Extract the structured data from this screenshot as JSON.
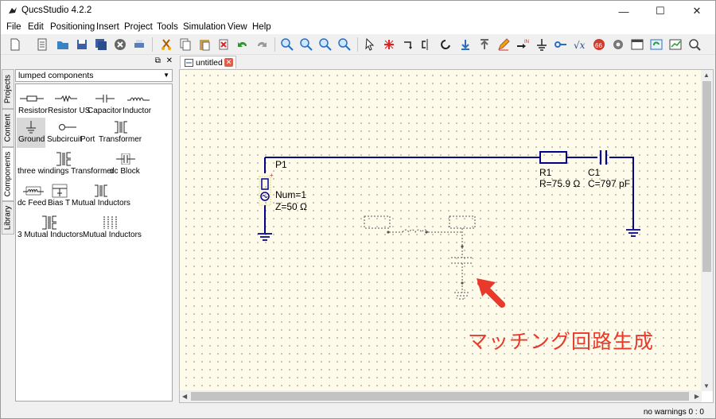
{
  "window": {
    "title": "QucsStudio 4.2.2",
    "minimize": "—",
    "maximize": "☐",
    "close": "✕"
  },
  "menu": [
    "File",
    "Edit",
    "Positioning",
    "Insert",
    "Project",
    "Tools",
    "Simulation",
    "View",
    "Help"
  ],
  "side_tabs": [
    "Projects",
    "Content",
    "Components",
    "Library"
  ],
  "dock": {
    "float": "⧉",
    "close": "✕"
  },
  "components_panel": {
    "category": "lumped components",
    "items": [
      "Resistor",
      "Resistor US",
      "Capacitor",
      "Inductor",
      "Ground",
      "Subcircuit",
      "Port",
      "Transformer",
      "three windings Transformer",
      "dc Block",
      "dc Feed",
      "Bias T",
      "Mutual Inductors",
      "3 Mutual Inductors",
      "Mutual Inductors"
    ]
  },
  "document_tab": {
    "label": "untitled",
    "close": "✕"
  },
  "schematic": {
    "port": {
      "name": "P1",
      "num": "Num=1",
      "z": "Z=50 Ω"
    },
    "resistor": {
      "name": "R1",
      "value": "R=75.9 Ω"
    },
    "capacitor": {
      "name": "C1",
      "value": "C=797 pF"
    }
  },
  "annotation": "マッチング回路生成",
  "status": "no warnings  0 : 0",
  "colors": {
    "wire": "#00008b",
    "canvas": "#fffbea",
    "annotation": "#e8392b"
  }
}
